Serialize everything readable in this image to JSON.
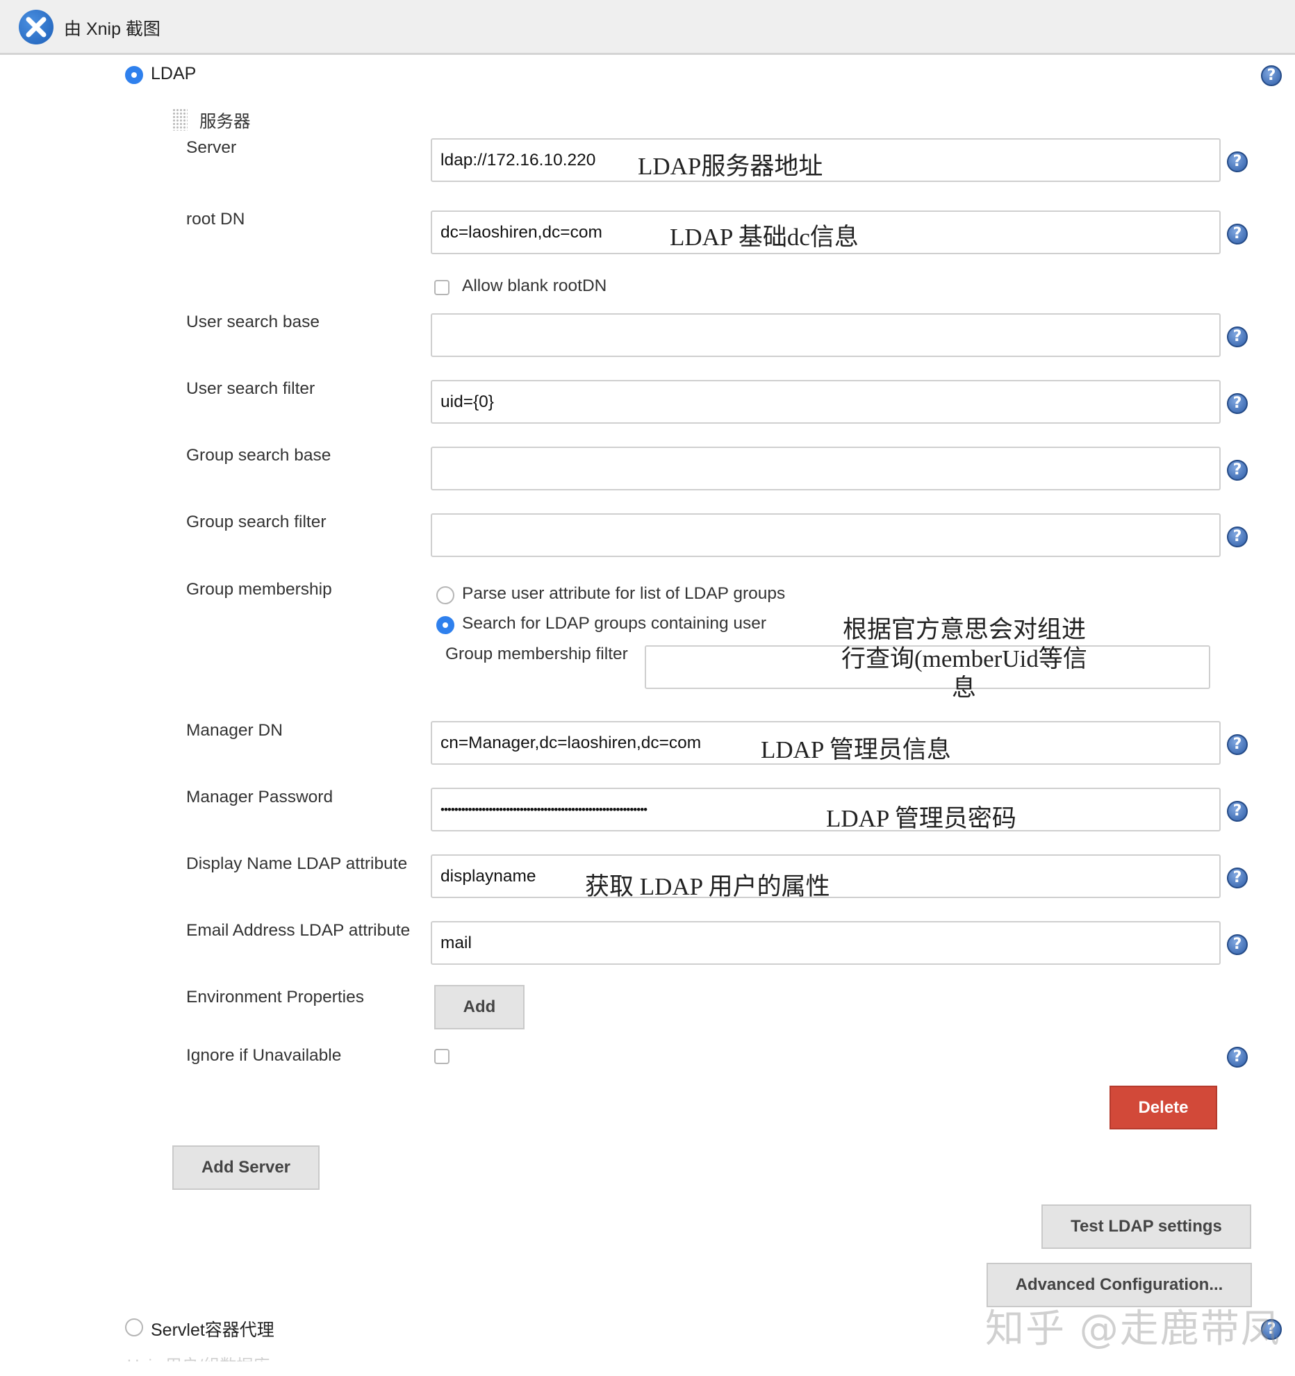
{
  "capture_bar": {
    "title": "由 Xnip 截图"
  },
  "realm": {
    "ldap_label": "LDAP",
    "servlet_label": "Servlet容器代理",
    "next_option_cutoff": "Unix 用户/组数据库"
  },
  "server_block": {
    "section_label": "服务器",
    "fields": {
      "server": {
        "label": "Server",
        "value": "ldap://172.16.10.220",
        "note": "LDAP服务器地址"
      },
      "root_dn": {
        "label": "root DN",
        "value": "dc=laoshiren,dc=com",
        "note": "LDAP 基础dc信息"
      },
      "allow_blank_rootdn": {
        "label": "Allow blank rootDN"
      },
      "user_search_base": {
        "label": "User search base",
        "value": ""
      },
      "user_search_filter": {
        "label": "User search filter",
        "value": "uid={0}"
      },
      "group_search_base": {
        "label": "Group search base",
        "value": ""
      },
      "group_search_filter": {
        "label": "Group search filter",
        "value": ""
      },
      "group_membership": {
        "label": "Group membership",
        "option_parse": "Parse user attribute for list of LDAP groups",
        "option_search": "Search for LDAP groups containing user",
        "filter_label": "Group membership filter",
        "filter_value": "",
        "note_lines": [
          "根据官方意思会对组进",
          "行查询(memberUid等信",
          "息"
        ]
      },
      "manager_dn": {
        "label": "Manager DN",
        "value": "cn=Manager,dc=laoshiren,dc=com",
        "note": "LDAP 管理员信息"
      },
      "manager_password": {
        "label": "Manager Password",
        "value": "••••••••••••••••••••••••••••••••••••••••••••••••••••••••••••",
        "note": "LDAP 管理员密码"
      },
      "display_name_attr": {
        "label": "Display Name LDAP attribute",
        "value": "displayname",
        "note": "获取 LDAP 用户的属性"
      },
      "email_attr": {
        "label": "Email Address LDAP attribute",
        "value": "mail"
      },
      "env_properties": {
        "label": "Environment Properties",
        "add_button": "Add"
      },
      "ignore_unavailable": {
        "label": "Ignore if Unavailable"
      }
    },
    "delete_button": "Delete"
  },
  "actions": {
    "add_server": "Add Server",
    "test_ldap": "Test LDAP settings",
    "advanced": "Advanced Configuration..."
  },
  "help_glyph": "?",
  "watermark": "知乎 @走鹿带凤"
}
